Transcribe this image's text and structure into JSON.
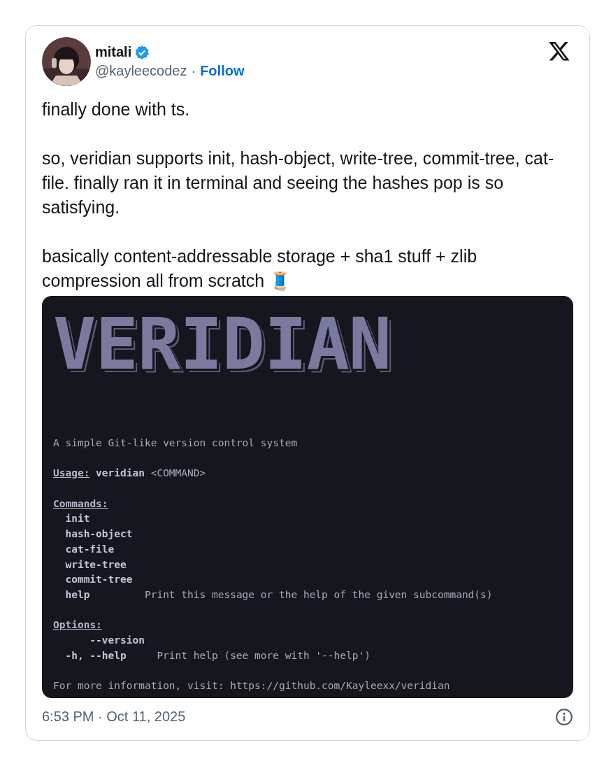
{
  "author": {
    "name": "mitali",
    "verified": true,
    "handle": "@kayleecodez",
    "separator": "·",
    "follow": "Follow"
  },
  "paragraphs": [
    "finally done with ts.",
    "so, veridian supports init, hash-object, write-tree, commit-tree, cat-file. finally ran it in terminal and seeing the hashes pop is so satisfying.",
    "basically content-addressable storage + sha1 stuff + zlib compression all from scratch 🧵"
  ],
  "terminal": {
    "banner": "VERIDIAN",
    "description": "A simple Git-like version control system",
    "usage": {
      "label": "Usage:",
      "command": "veridian",
      "argument": "<COMMAND>"
    },
    "commands_heading": "Commands:",
    "commands": [
      {
        "name": "init"
      },
      {
        "name": "hash-object"
      },
      {
        "name": "cat-file"
      },
      {
        "name": "write-tree"
      },
      {
        "name": "commit-tree"
      },
      {
        "name": "help",
        "description": "Print this message or the help of the given subcommand(s)"
      }
    ],
    "options_heading": "Options:",
    "options": [
      {
        "long": "--version"
      },
      {
        "short": "-h,",
        "long": "--help",
        "description": "Print help (see more with '--help')"
      }
    ],
    "footer_label": "For more information, visit:",
    "footer_link": "https://github.com/Kayleexx/veridian"
  },
  "timestamp": "6:53 PM · Oct 11, 2025"
}
